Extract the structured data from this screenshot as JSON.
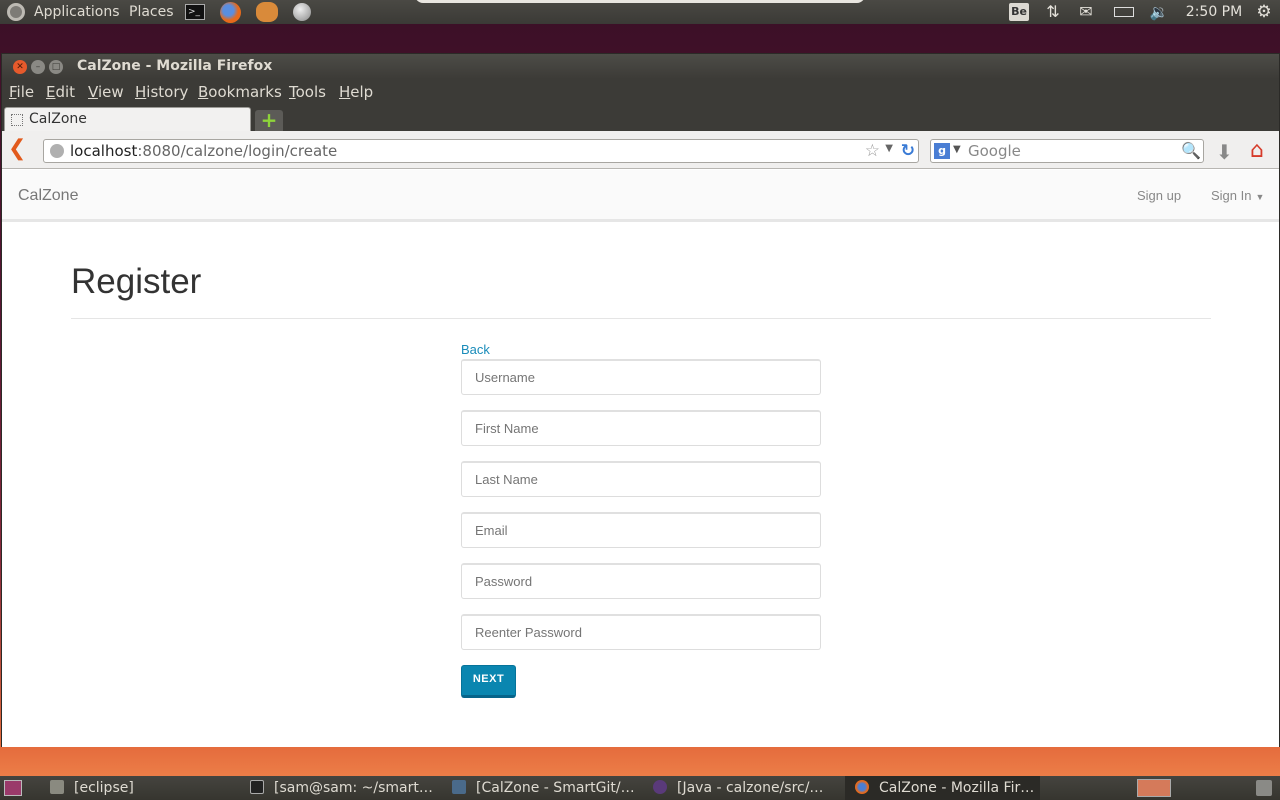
{
  "top_panel": {
    "applications": "Applications",
    "places": "Places",
    "clock": "2:50 PM",
    "keyboard_layout": "Be"
  },
  "window": {
    "title": "CalZone - Mozilla Firefox"
  },
  "menubar": {
    "items": [
      "File",
      "Edit",
      "View",
      "History",
      "Bookmarks",
      "Tools",
      "Help"
    ],
    "mnemonics": [
      "F",
      "E",
      "V",
      "H",
      "B",
      "T",
      "H"
    ]
  },
  "tab": {
    "label": "CalZone"
  },
  "urlbar": {
    "host": "localhost",
    "path": ":8080/calzone/login/create"
  },
  "searchbar": {
    "placeholder": "Google"
  },
  "site": {
    "brand": "CalZone",
    "signup": "Sign up",
    "signin": "Sign In"
  },
  "page": {
    "title": "Register",
    "back_link": "Back",
    "fields": [
      {
        "name": "username",
        "placeholder": "Username"
      },
      {
        "name": "first-name",
        "placeholder": "First Name"
      },
      {
        "name": "last-name",
        "placeholder": "Last Name"
      },
      {
        "name": "email",
        "placeholder": "Email"
      },
      {
        "name": "password",
        "placeholder": "Password"
      },
      {
        "name": "reenter-password",
        "placeholder": "Reenter Password"
      }
    ],
    "next_label": "NEXT"
  },
  "taskbar": {
    "tasks": [
      {
        "label": "[eclipse]",
        "icon": "eclipse-window-icon"
      },
      {
        "label": "[sam@sam: ~/smart…",
        "icon": "terminal-icon"
      },
      {
        "label": "[CalZone - SmartGit/…",
        "icon": "smartgit-icon"
      },
      {
        "label": "[Java - calzone/src/…",
        "icon": "eclipse-icon"
      },
      {
        "label": "CalZone - Mozilla Fir…",
        "icon": "firefox-icon"
      }
    ]
  },
  "colors": {
    "accent": "#0a86b0",
    "link": "#1a8cba",
    "panel": "#3c3b37"
  }
}
